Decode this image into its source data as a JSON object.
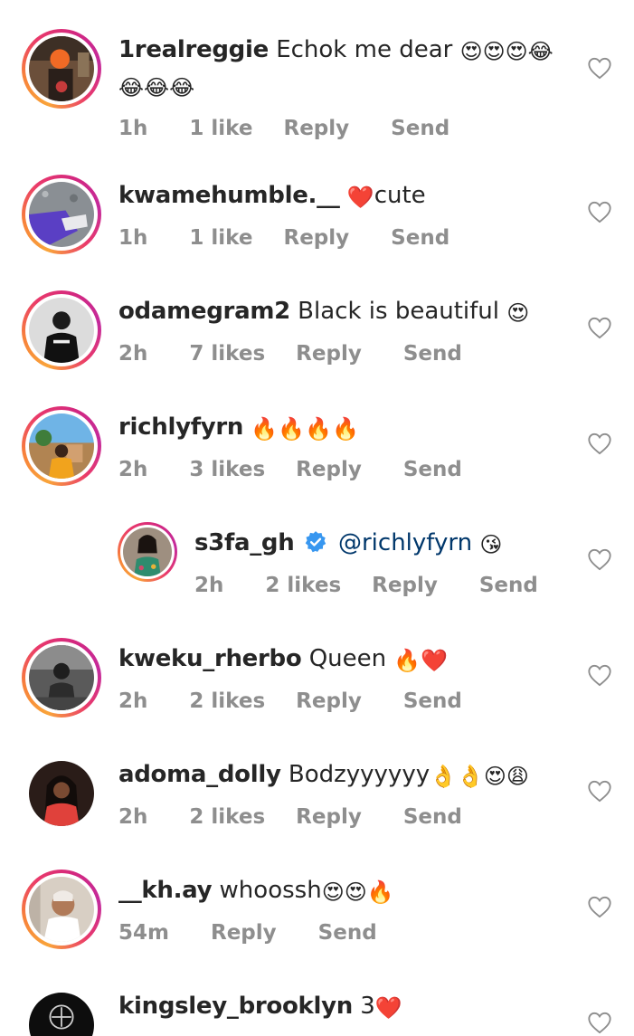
{
  "comments": [
    {
      "username": "1realreggie",
      "text": "Echok me dear",
      "emoji_line1": "😍😍😍😂",
      "emoji_line2": "😂😂😂",
      "time": "1h",
      "likes": "1 like",
      "reply": "Reply",
      "send": "Send"
    },
    {
      "username": "kwamehumble.__",
      "emoji": "❤️",
      "text": "cute",
      "time": "1h",
      "likes": "1 like",
      "reply": "Reply",
      "send": "Send"
    },
    {
      "username": "odamegram2",
      "text": "Black is beautiful",
      "emoji": "😍",
      "time": "2h",
      "likes": "7 likes",
      "reply": "Reply",
      "send": "Send"
    },
    {
      "username": "richlyfyrn",
      "emoji": "🔥🔥🔥🔥",
      "time": "2h",
      "likes": "3 likes",
      "reply": "Reply",
      "send": "Send"
    },
    {
      "username": "s3fa_gh",
      "mention": "@richlyfyrn",
      "emoji": "😘",
      "time": "2h",
      "likes": "2 likes",
      "reply": "Reply",
      "send": "Send"
    },
    {
      "username": "kweku_rherbo",
      "text": "Queen",
      "emoji": "🔥❤️",
      "time": "2h",
      "likes": "2 likes",
      "reply": "Reply",
      "send": "Send"
    },
    {
      "username": "adoma_dolly",
      "text": "Bodzyyyyyy",
      "emoji": "👌👌😍😩",
      "time": "2h",
      "likes": "2 likes",
      "reply": "Reply",
      "send": "Send"
    },
    {
      "username": "__kh.ay",
      "text": "whoossh",
      "emoji": "😍😍🔥",
      "time": "54m",
      "reply": "Reply",
      "send": "Send"
    },
    {
      "username": "kingsley_brooklyn",
      "text": "3",
      "emoji": "❤️"
    }
  ],
  "colors": {
    "text": "#262626",
    "meta": "#8e8e8e",
    "mention": "#00376b",
    "verified": "#3897f0"
  }
}
